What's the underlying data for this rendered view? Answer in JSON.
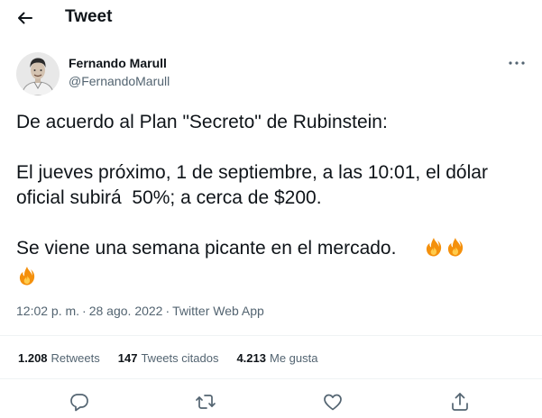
{
  "header": {
    "title": "Tweet",
    "back_icon": "arrow-left-icon"
  },
  "author": {
    "name": "Fernando Marull",
    "handle": "@FernandoMarull",
    "avatar_icon": "profile-photo"
  },
  "tweet": {
    "line1": "De acuerdo al Plan \"Secreto\" de Rubinstein:",
    "line2a": "El jueves próximo, 1 de septiembre, a las 10:01, el dólar",
    "line2b": "oficial subirá  50%; a cerca de $200.",
    "line3": "Se viene una semana picante en el mercado.     ",
    "emoji_icon": "fire-icon"
  },
  "meta": {
    "time": "12:02 p. m.",
    "separator": "·",
    "date": "28 ago. 2022",
    "source": "Twitter Web App"
  },
  "stats": {
    "retweets_count": "1.208",
    "retweets_label": "Retweets",
    "quotes_count": "147",
    "quotes_label": "Tweets citados",
    "likes_count": "4.213",
    "likes_label": "Me gusta"
  },
  "actions": [
    "reply-icon",
    "retweet-icon",
    "like-icon",
    "share-icon"
  ],
  "colors": {
    "text": "#0f1419",
    "secondary": "#536471",
    "divider": "#eff3f4",
    "fire": "#f4900c"
  }
}
